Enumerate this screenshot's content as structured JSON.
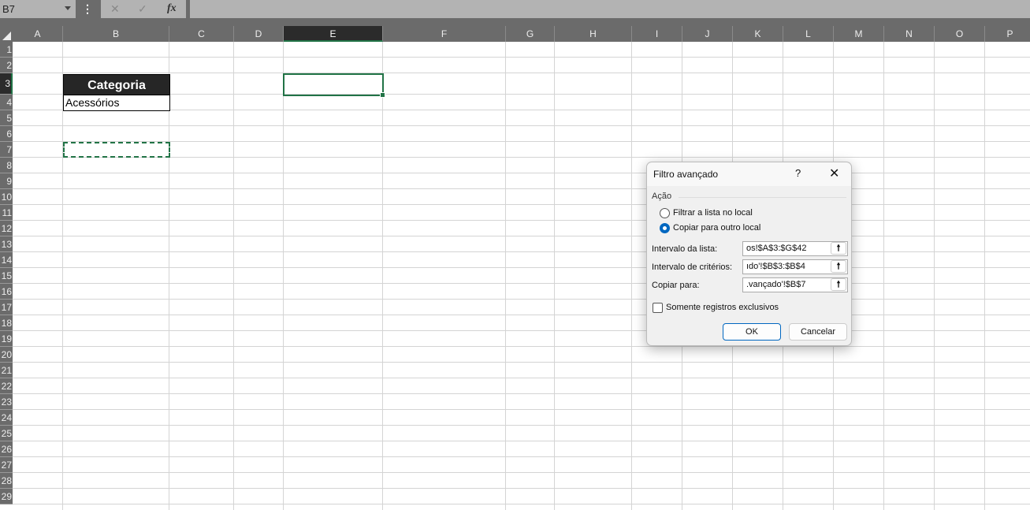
{
  "formula_bar": {
    "name_box": "B7",
    "fx_label": "fx",
    "cancel_icon": "✕",
    "enter_icon": "✓",
    "formula": ""
  },
  "columns": [
    "A",
    "B",
    "C",
    "D",
    "E",
    "F",
    "G",
    "H",
    "I",
    "J",
    "K",
    "L",
    "M",
    "N",
    "O",
    "P"
  ],
  "selected_column": "E",
  "rows": [
    "1",
    "2",
    "3",
    "4",
    "5",
    "6",
    "7",
    "8",
    "9",
    "10",
    "11",
    "12",
    "13",
    "14",
    "15",
    "16",
    "17",
    "18",
    "19",
    "20",
    "21",
    "22",
    "23",
    "24",
    "25",
    "26",
    "27",
    "28",
    "29"
  ],
  "selected_row": "3",
  "cells": {
    "B3": "Categoria",
    "B4": "Acessórios"
  },
  "dialog": {
    "title": "Filtro avançado",
    "help": "?",
    "close": "✕",
    "group_label": "Ação",
    "radio_filter": "Filtrar a lista no local",
    "radio_copy": "Copiar para outro local",
    "list_range_label": "Intervalo da lista:",
    "list_range_value": "os!$A$3:$G$42",
    "criteria_label": "Intervalo de critérios:",
    "criteria_value": "ıdo'!$B$3:$B$4",
    "copy_to_label": "Copiar para:",
    "copy_to_value": ".vançado'!$B$7",
    "unique_label": "Somente registros exclusivos",
    "ok": "OK",
    "cancel": "Cancelar",
    "collapse_icon": "🠕"
  }
}
